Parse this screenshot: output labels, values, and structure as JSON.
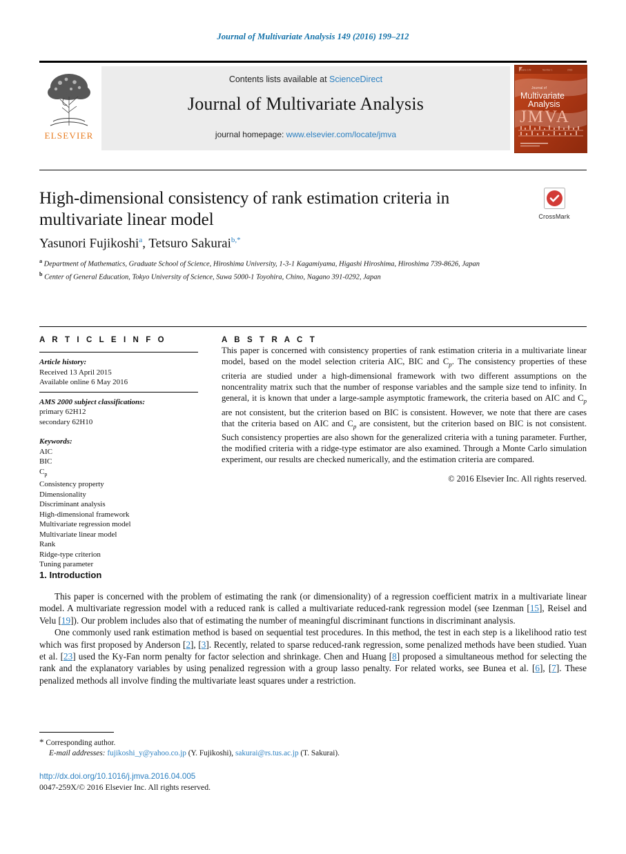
{
  "running_head": "Journal of Multivariate Analysis 149 (2016) 199–212",
  "masthead": {
    "contents_prefix": "Contents lists available at",
    "contents_link": "ScienceDirect",
    "journal_name": "Journal of Multivariate Analysis",
    "homepage_prefix": "journal homepage:",
    "homepage_link": "www.elsevier.com/locate/jmva",
    "publisher_word": "ELSEVIER",
    "cover": {
      "small_top": "Journal of",
      "line1": "Multivariate",
      "line2": "Analysis",
      "acronym": "JMVA"
    }
  },
  "crossmark": {
    "label": "CrossMark"
  },
  "article": {
    "title": "High-dimensional consistency of rank estimation criteria in multivariate linear model",
    "authors": [
      {
        "name": "Yasunori Fujikoshi",
        "marks": "a"
      },
      {
        "name": "Tetsuro Sakurai",
        "marks": "b,*"
      }
    ],
    "affiliations": [
      {
        "mark": "a",
        "text": "Department of Mathematics, Graduate School of Science, Hiroshima University, 1-3-1 Kagamiyama, Higashi Hiroshima, Hiroshima 739-8626, Japan"
      },
      {
        "mark": "b",
        "text": "Center of General Education, Tokyo University of Science, Suwa 5000-1 Toyohira, Chino, Nagano 391-0292, Japan"
      }
    ]
  },
  "info": {
    "heading": "A R T I C L E    I N F O",
    "history_label": "Article history:",
    "history": [
      "Received 13 April 2015",
      "Available online 6 May 2016"
    ],
    "ams_label": "AMS 2000 subject classifications:",
    "ams": [
      "primary 62H12",
      "secondary 62H10"
    ],
    "keywords_label": "Keywords:",
    "keywords": [
      "AIC",
      "BIC",
      "Cp",
      "Consistency property",
      "Dimensionality",
      "Discriminant analysis",
      "High-dimensional framework",
      "Multivariate regression model",
      "Multivariate linear model",
      "Rank",
      "Ridge-type criterion",
      "Tuning parameter"
    ]
  },
  "abstract": {
    "heading": "A B S T R A C T",
    "paragraph_1": "This paper is concerned with consistency properties of rank estimation criteria in a multivariate linear model, based on the model selection criteria AIC, BIC and C",
    "paragraph_1b": ". The consistency properties of these criteria are studied under a high-dimensional framework with two different assumptions on the noncentrality matrix such that the number of response variables and the sample size tend to infinity. In general, it is known that under a large-sample asymptotic framework, the criteria based on AIC and C",
    "paragraph_1c": " are not consistent, but the criterion based on BIC is consistent. However, we note that there are cases that the criteria based on AIC and C",
    "paragraph_1d": " are consistent, but the criterion based on BIC is not consistent. Such consistency properties are also shown for the generalized criteria with a tuning parameter. Further, the modified criteria with a ridge-type estimator are also examined. Through a Monte Carlo simulation experiment, our results are checked numerically, and the estimation criteria are compared.",
    "subscript_p": "p",
    "copyright": "© 2016 Elsevier Inc. All rights reserved."
  },
  "body": {
    "section_number": "1.",
    "section_title": "Introduction",
    "para1_a": "This paper is concerned with the problem of estimating the rank (or dimensionality) of a regression coefficient matrix in a multivariate linear model. A multivariate regression model with a reduced rank is called a multivariate reduced-rank regression model (see Izenman [",
    "para1_cite1": "15",
    "para1_b": "], Reisel and Velu [",
    "para1_cite2": "19",
    "para1_c": "]). Our problem includes also that of estimating the number of meaningful discriminant functions in discriminant analysis.",
    "para2_a": "One commonly used rank estimation method is based on sequential test procedures. In this method, the test in each step is a likelihood ratio test which was first proposed by Anderson [",
    "para2_cite1": "2",
    "para2_b": "], [",
    "para2_cite2": "3",
    "para2_c": "]. Recently, related to sparse reduced-rank regression, some penalized methods have been studied. Yuan et al. [",
    "para2_cite3": "23",
    "para2_d": "] used the Ky-Fan norm penalty for factor selection and shrinkage. Chen and Huang [",
    "para2_cite4": "8",
    "para2_e": "] proposed a simultaneous method for selecting the rank and the explanatory variables by using penalized regression with a group lasso penalty. For related works, see Bunea et al. [",
    "para2_cite5": "6",
    "para2_f": "], [",
    "para2_cite6": "7",
    "para2_g": "]. These penalized methods all involve finding the multivariate least squares under a restriction."
  },
  "footer": {
    "star": "*",
    "corresponding": "Corresponding author.",
    "email_label": "E-mail addresses:",
    "email_1": "fujikoshi_y@yahoo.co.jp",
    "email_1_owner": "(Y. Fujikoshi),",
    "email_2": "sakurai@rs.tus.ac.jp",
    "email_2_owner": "(T. Sakurai).",
    "doi": "http://dx.doi.org/10.1016/j.jmva.2016.04.005",
    "issn": "0047-259X/© 2016 Elsevier Inc. All rights reserved."
  },
  "colors": {
    "link": "#2a7fc0",
    "running_head": "#1070a8",
    "elsevier_orange": "#e87b1e",
    "cover_red": "#b23a14"
  }
}
